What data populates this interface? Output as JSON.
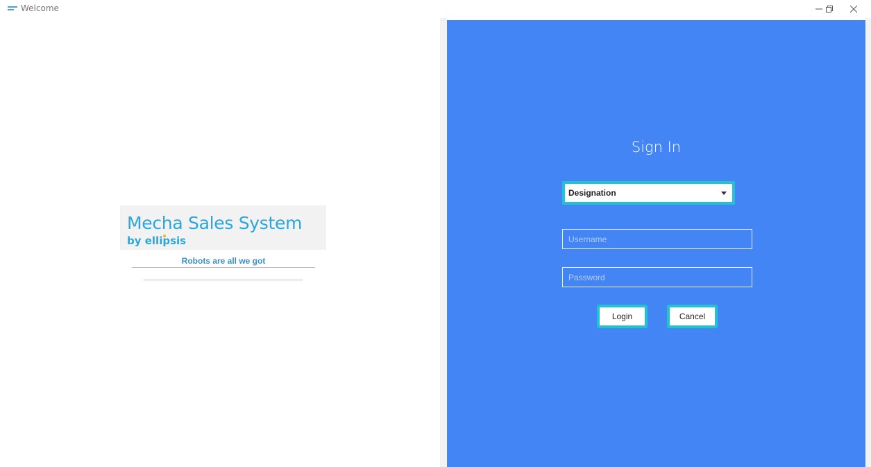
{
  "window": {
    "title": "Welcome",
    "controls": {
      "minimize": "minimize-icon",
      "maximize": "restore-icon",
      "close": "close-icon"
    }
  },
  "branding": {
    "product": "Mecha Sales System",
    "by": "by ellipsis",
    "tagline": "Robots are all we got",
    "brand_color": "#2ba6d9"
  },
  "signin": {
    "title": "Sign In",
    "designation": {
      "selected": "Designation"
    },
    "username": {
      "placeholder": "Username",
      "value": ""
    },
    "password": {
      "placeholder": "Password",
      "value": ""
    },
    "login_label": "Login",
    "cancel_label": "Cancel",
    "panel_color": "#4485f5",
    "accent_color": "#22c2d2"
  }
}
